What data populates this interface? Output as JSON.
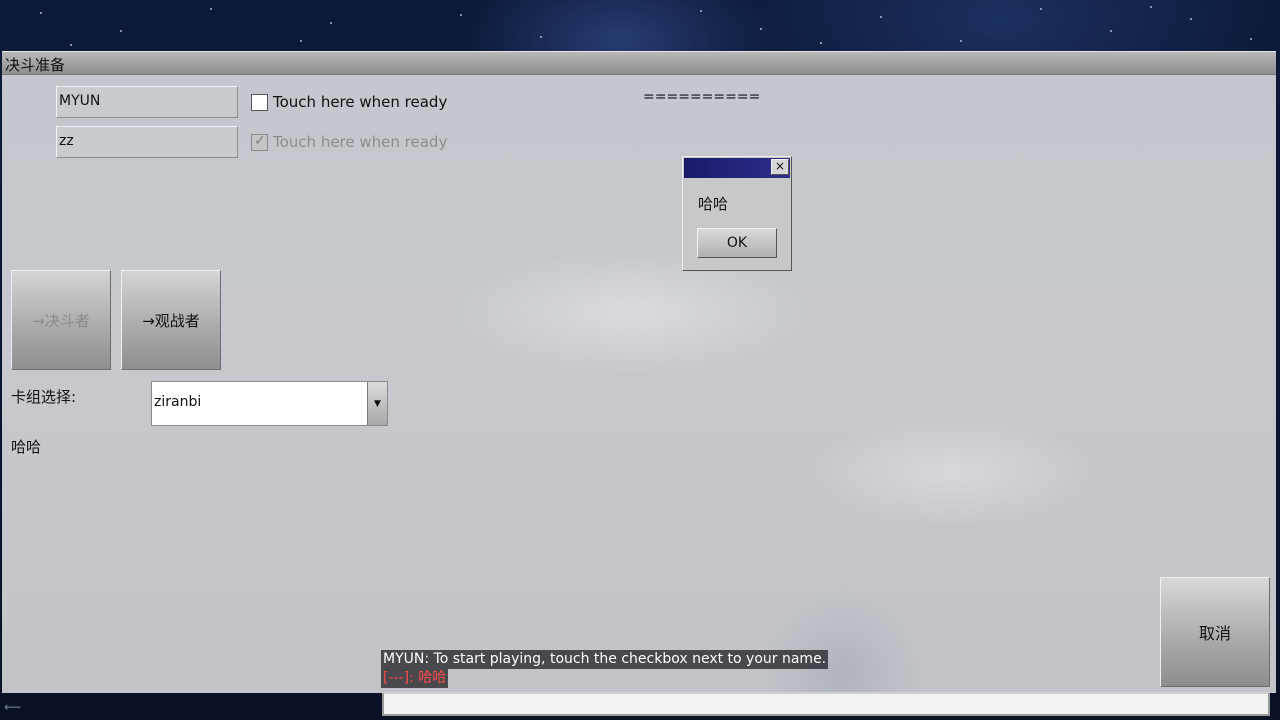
{
  "window": {
    "title": "决斗准备"
  },
  "players": [
    {
      "name": "MYUN",
      "ready_label": "Touch here when ready",
      "ready": false,
      "enabled": true
    },
    {
      "name": "zz",
      "ready_label": "Touch here when ready",
      "ready": true,
      "enabled": false
    }
  ],
  "separator": "==========",
  "buttons": {
    "to_duelist": "→决斗者",
    "to_observer": "→观战者",
    "cancel": "取消"
  },
  "deck": {
    "label": "卡组选择:",
    "selected": "ziranbi",
    "dropdown_icon": "triangle-down"
  },
  "host_message": "哈哈",
  "dialog": {
    "close": "×",
    "message": "哈哈",
    "ok": "OK"
  },
  "chat": {
    "lines": [
      {
        "text": "MYUN: To start playing, touch the checkbox next to your name."
      },
      {
        "text": "[---]: 哈哈"
      }
    ],
    "input_value": ""
  },
  "colors": {
    "dialog_title": "#2e2e8c",
    "chat_system": "#ff4a4a"
  }
}
